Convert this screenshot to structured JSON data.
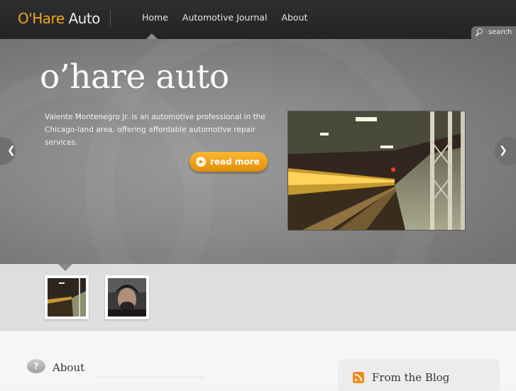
{
  "site": {
    "logo_part1": "O'Hare",
    "logo_part2": "Auto"
  },
  "nav": {
    "items": [
      {
        "label": "Home",
        "active": true
      },
      {
        "label": "Automotive Journal"
      },
      {
        "label": "About"
      }
    ],
    "search_label": "search"
  },
  "hero": {
    "title": "o’hare auto",
    "description": "Valente Montenegro Jr. is an automotive professional in the Chicago-land area, offering affordable automotive repair services.",
    "read_more": "read more",
    "prev_arrow": "❮",
    "next_arrow": "❯"
  },
  "thumbnails": [
    {
      "alt": "train platform at night"
    },
    {
      "alt": "portrait of man"
    }
  ],
  "sections": {
    "about_icon": "?",
    "about_heading": "About",
    "blog_heading": "From the Blog"
  },
  "colors": {
    "accent": "#e9a623",
    "button": "#f5a21a",
    "topbar": "#2a2a2a"
  }
}
